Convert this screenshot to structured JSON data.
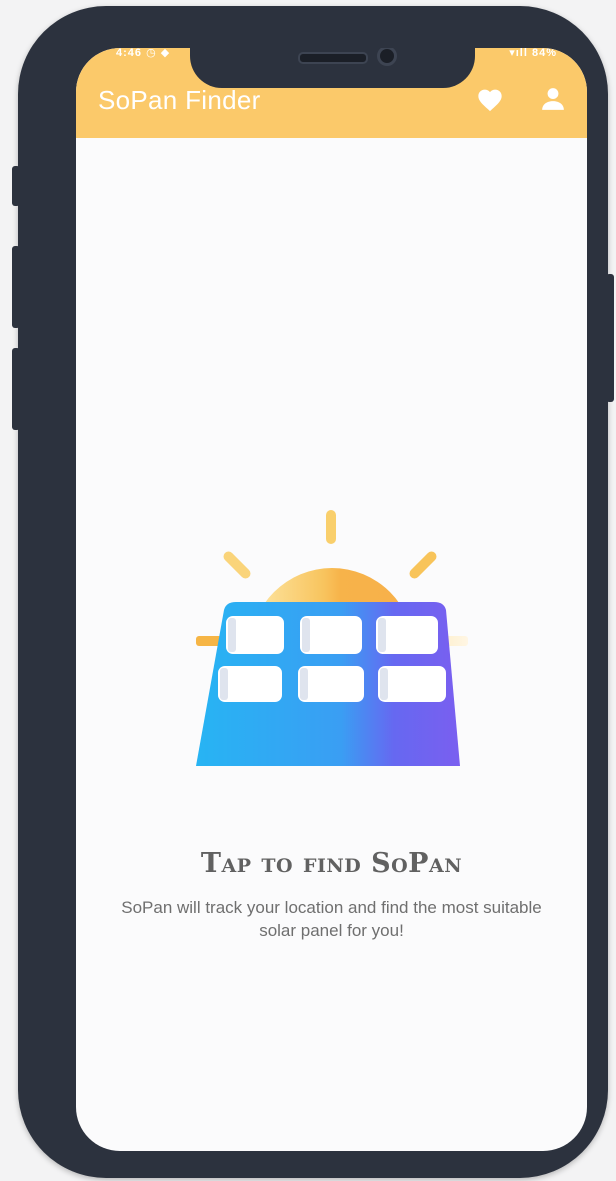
{
  "statusbar": {
    "left": "4:46 ◷ ◆",
    "right": "▾ıll 84%"
  },
  "appbar": {
    "title": "SoPan Finder",
    "favorite_icon": "heart-icon",
    "profile_icon": "person-icon",
    "color": "#fbc96a"
  },
  "main": {
    "heading": "Tap to find SoPan",
    "description": "SoPan will track your location and find the most suitable solar panel for you!",
    "illustration": "sun-over-solar-panel"
  },
  "colors": {
    "accent": "#fbc96a",
    "sun": "#f7b34a",
    "panel_start": "#2ab3f2",
    "panel_end": "#6a67f0",
    "background": "#fbfbfc",
    "frame": "#2c323e"
  }
}
